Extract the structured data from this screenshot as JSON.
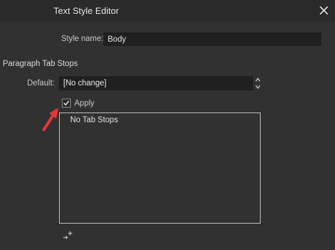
{
  "window": {
    "title": "Text Style Editor",
    "close_icon": "close-icon"
  },
  "style_name": {
    "label": "Style name:",
    "value": "Body"
  },
  "section_title": "Paragraph Tab Stops",
  "default": {
    "label": "Default:",
    "value": "[No change]"
  },
  "apply": {
    "label": "Apply",
    "checked": true
  },
  "tab_stops_list": {
    "empty_text": "No Tab Stops"
  },
  "icons": {
    "add": "add-tab-stop-icon",
    "annotation": "red-arrow-annotation"
  },
  "colors": {
    "background": "#313131",
    "field": "#202020",
    "annotation": "#e8373a"
  }
}
